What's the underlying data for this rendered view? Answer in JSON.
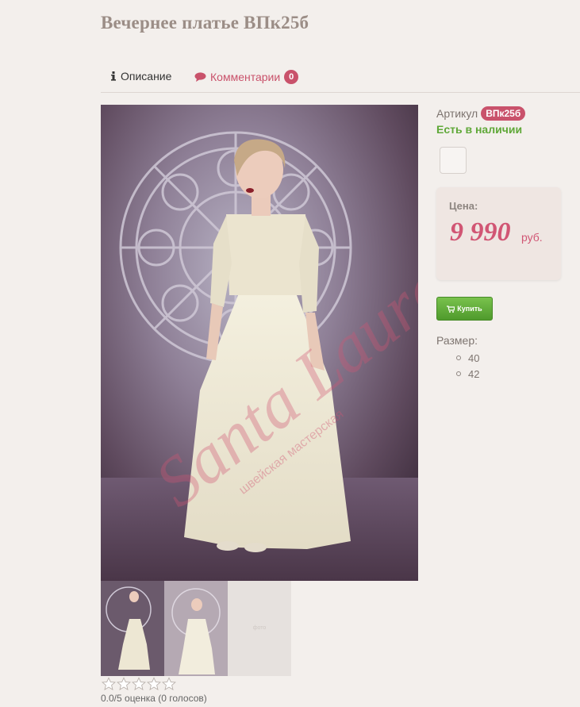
{
  "product": {
    "title": "Вечернее платье ВПк25б",
    "sku_label": "Артикул",
    "sku": "ВПк25б",
    "stock": "Есть в наличии",
    "price_label": "Цена:",
    "price": "9 990",
    "currency": "руб.",
    "buy_label": "Купить",
    "size_label": "Размер:",
    "sizes": [
      "40",
      "42"
    ],
    "watermark": "Santa Laura",
    "watermark_sub": "швейская мастерская"
  },
  "tabs": [
    {
      "label": "Описание",
      "icon": "info-icon"
    },
    {
      "label": "Комментарии",
      "icon": "comment-icon",
      "count": "0"
    }
  ],
  "gallery": {
    "placeholder_text": "фото"
  },
  "rating": {
    "text": "0.0/5 оценка (0 голосов)",
    "value": 0,
    "max": 5
  },
  "colors": {
    "accent": "#c9526b",
    "stock": "#5fa838",
    "buy": "#5da634",
    "price": "#d15674"
  }
}
